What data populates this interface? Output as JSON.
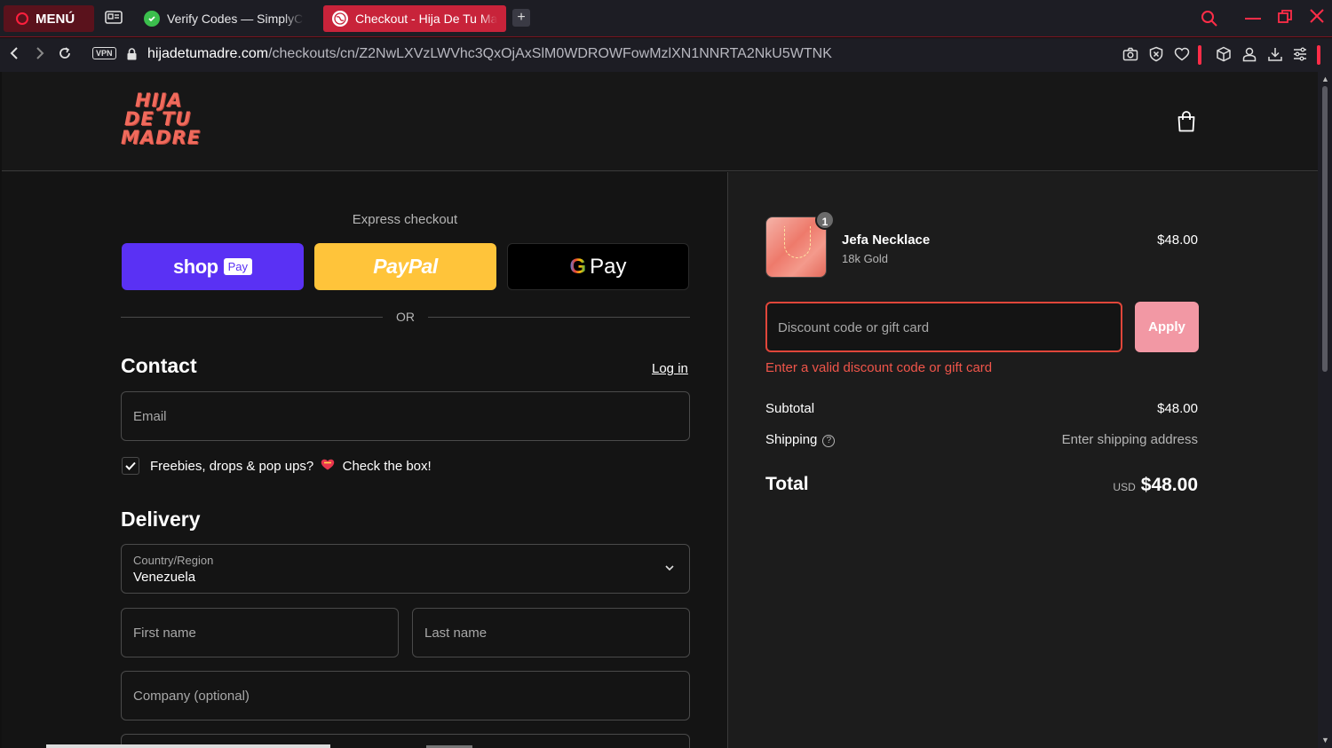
{
  "browser": {
    "menu_label": "MENÚ",
    "tabs": [
      {
        "title": "Verify Codes — SimplyCodes",
        "active": false
      },
      {
        "title": "Checkout - Hija De Tu Madre",
        "active": true
      }
    ],
    "new_tab_label": "+",
    "url_host": "hijadetumadre.com",
    "url_path": "/checkouts/cn/Z2NwLXVzLWVhc3QxOjAxSlM0WDROWFowMzlXN1NNRTA2NkU5WTNK",
    "vpn_label": "VPN"
  },
  "header": {
    "logo_lines": [
      "HIJA",
      "DE TU",
      "MADRE"
    ]
  },
  "checkout": {
    "express_label": "Express checkout",
    "shop_pay": {
      "word": "shop",
      "badge": "Pay"
    },
    "paypal": {
      "word": "PayPal"
    },
    "gpay": {
      "g": "G",
      "word": "Pay"
    },
    "or_label": "OR",
    "contact_title": "Contact",
    "login_label": "Log in",
    "email_placeholder": "Email",
    "newsletter_text_a": "Freebies, drops & pop ups?",
    "newsletter_text_b": "Check the box!",
    "newsletter_checked": true,
    "delivery_title": "Delivery",
    "country_label": "Country/Region",
    "country_value": "Venezuela",
    "first_name_placeholder": "First name",
    "last_name_placeholder": "Last name",
    "company_placeholder": "Company (optional)"
  },
  "summary": {
    "item": {
      "quantity": "1",
      "name": "Jefa Necklace",
      "variant": "18k Gold",
      "price": "$48.00"
    },
    "discount_placeholder": "Discount code or gift card",
    "apply_label": "Apply",
    "discount_error": "Enter a valid discount code or gift card",
    "subtotal_label": "Subtotal",
    "subtotal_value": "$48.00",
    "shipping_label": "Shipping",
    "shipping_value": "Enter shipping address",
    "total_label": "Total",
    "total_currency": "USD",
    "total_value": "$48.00"
  },
  "colors": {
    "accent_red": "#ff2d48",
    "shop_pay": "#5a31f4",
    "paypal": "#ffc43a",
    "error": "#f0554a",
    "apply_button": "#f298a4"
  }
}
